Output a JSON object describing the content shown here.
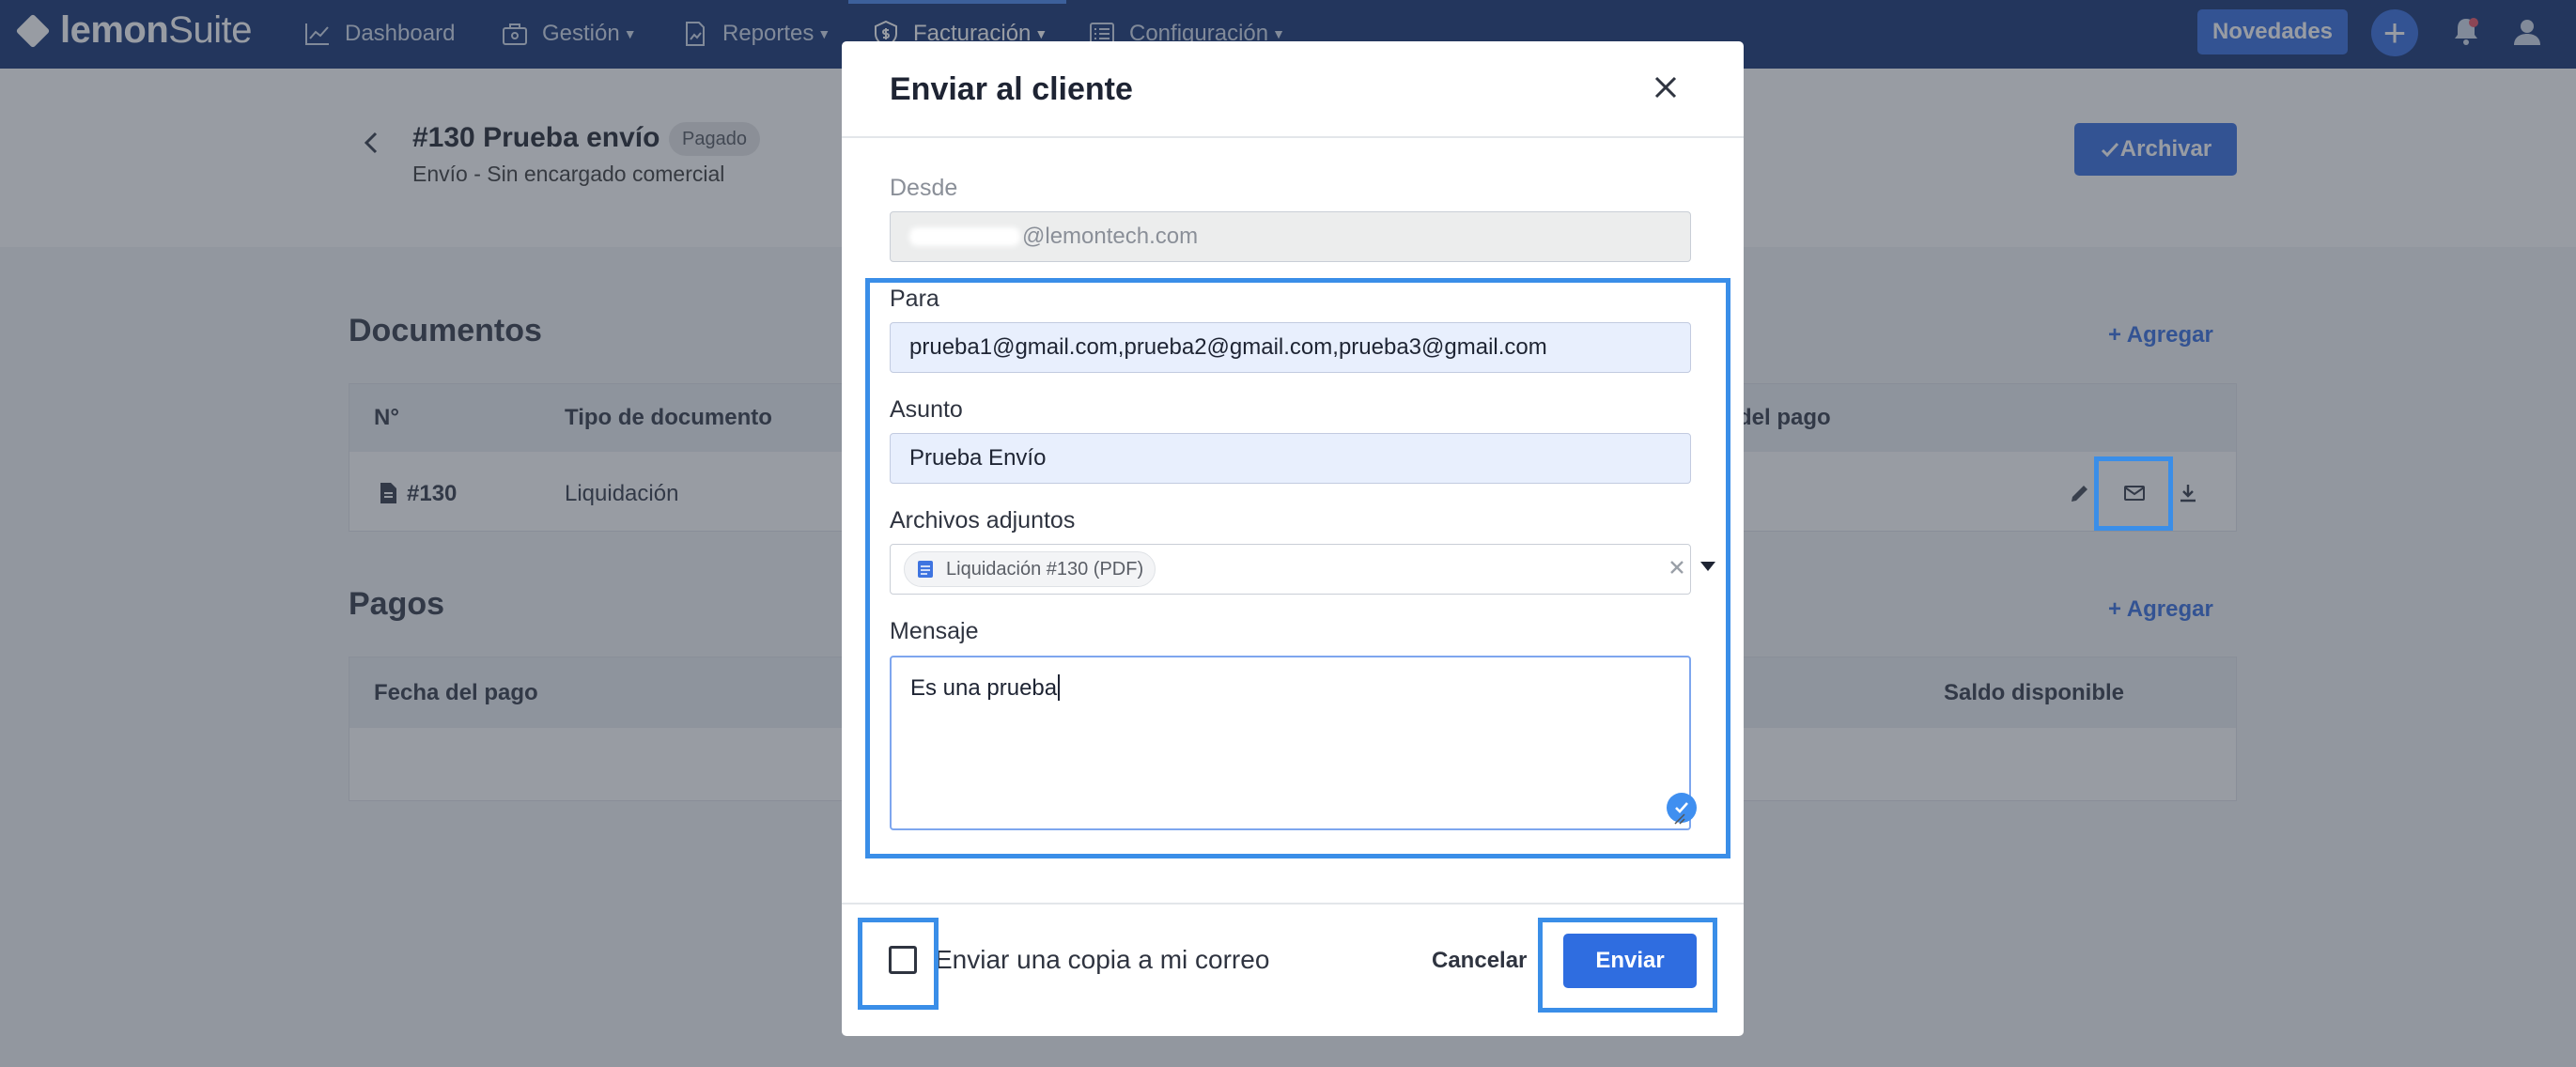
{
  "nav": {
    "logo_bold": "lemon",
    "logo_light": "Suite",
    "items": [
      {
        "label": "Dashboard",
        "icon": "chart-icon"
      },
      {
        "label": "Gestión",
        "icon": "briefcase-icon"
      },
      {
        "label": "Reportes",
        "icon": "report-icon"
      },
      {
        "label": "Facturación",
        "icon": "billing-icon"
      },
      {
        "label": "Configuración",
        "icon": "settings-list-icon"
      }
    ],
    "novedades_label": "Novedades",
    "plus_label": "+"
  },
  "record": {
    "title": "#130 Prueba envío",
    "status_badge": "Pagado",
    "subtitle": "Envío - Sin encargado comercial",
    "archive_label": "Archivar"
  },
  "documents": {
    "title": "Documentos",
    "add_label": "Agregar",
    "columns": [
      "N°",
      "Tipo de documento",
      "del pago"
    ],
    "rows": [
      {
        "number": "#130",
        "type": "Liquidación"
      }
    ]
  },
  "payments": {
    "title": "Pagos",
    "add_label": "Agregar",
    "columns": [
      "Fecha del pago",
      "Saldo disponible"
    ]
  },
  "modal": {
    "title": "Enviar al cliente",
    "from_label": "Desde",
    "from_value": "@lemontech.com",
    "to_label": "Para",
    "to_value": "prueba1@gmail.com,prueba2@gmail.com,prueba3@gmail.com",
    "subject_label": "Asunto",
    "subject_value": "Prueba Envío",
    "attachments_label": "Archivos adjuntos",
    "attachment_chip": "Liquidación #130 (PDF)",
    "message_label": "Mensaje",
    "message_value": "Es una prueba",
    "copy_label": "Enviar una copia a mi correo",
    "copy_checked": false,
    "cancel_label": "Cancelar",
    "send_label": "Enviar"
  },
  "colors": {
    "nav_bg": "#1f3d7a",
    "primary": "#3f74e0",
    "highlight": "#3a8ee8"
  }
}
